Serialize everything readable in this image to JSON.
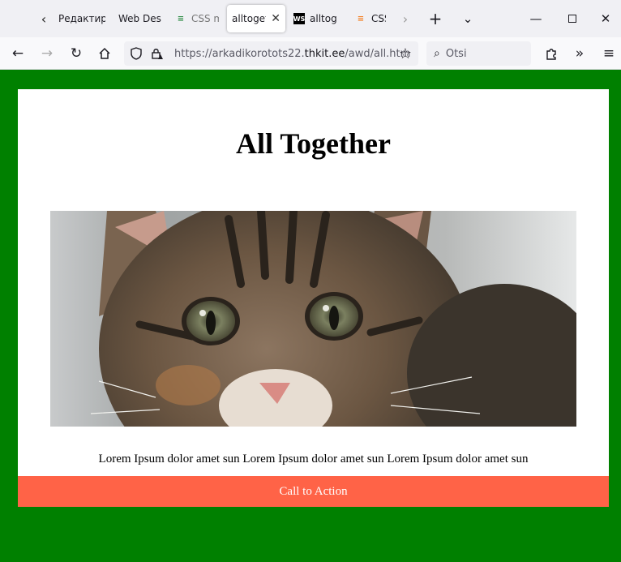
{
  "browser": {
    "tabs": [
      {
        "label": "Редактиро",
        "favicon": "page-icon",
        "active": false
      },
      {
        "label": "Web Desig",
        "favicon": "page-icon",
        "active": false
      },
      {
        "label": "CSS m",
        "favicon": "geeksforgeeks-icon",
        "active": false
      },
      {
        "label": "alltoget",
        "favicon": "none",
        "active": true
      },
      {
        "label": "alltog",
        "favicon": "webstorm-icon",
        "active": false
      },
      {
        "label": "CSS",
        "favicon": "stackoverflow-icon",
        "active": false
      }
    ],
    "url_prefix": "https://arkadikorotots22.",
    "url_domain": "thkit.ee",
    "url_path": "/awd/all.htm",
    "search_placeholder": "Otsi",
    "colors": {
      "tabbar": "#f0f0f4",
      "navbar": "#f9f9fb"
    }
  },
  "page": {
    "background": "#008000",
    "heading": "All Together",
    "image_alt": "kitten",
    "paragraph": "Lorem Ipsum dolor amet sun Lorem Ipsum dolor amet sun Lorem Ipsum dolor amet sun",
    "cta_label": "Call to Action",
    "cta_color": "#ff6347"
  }
}
